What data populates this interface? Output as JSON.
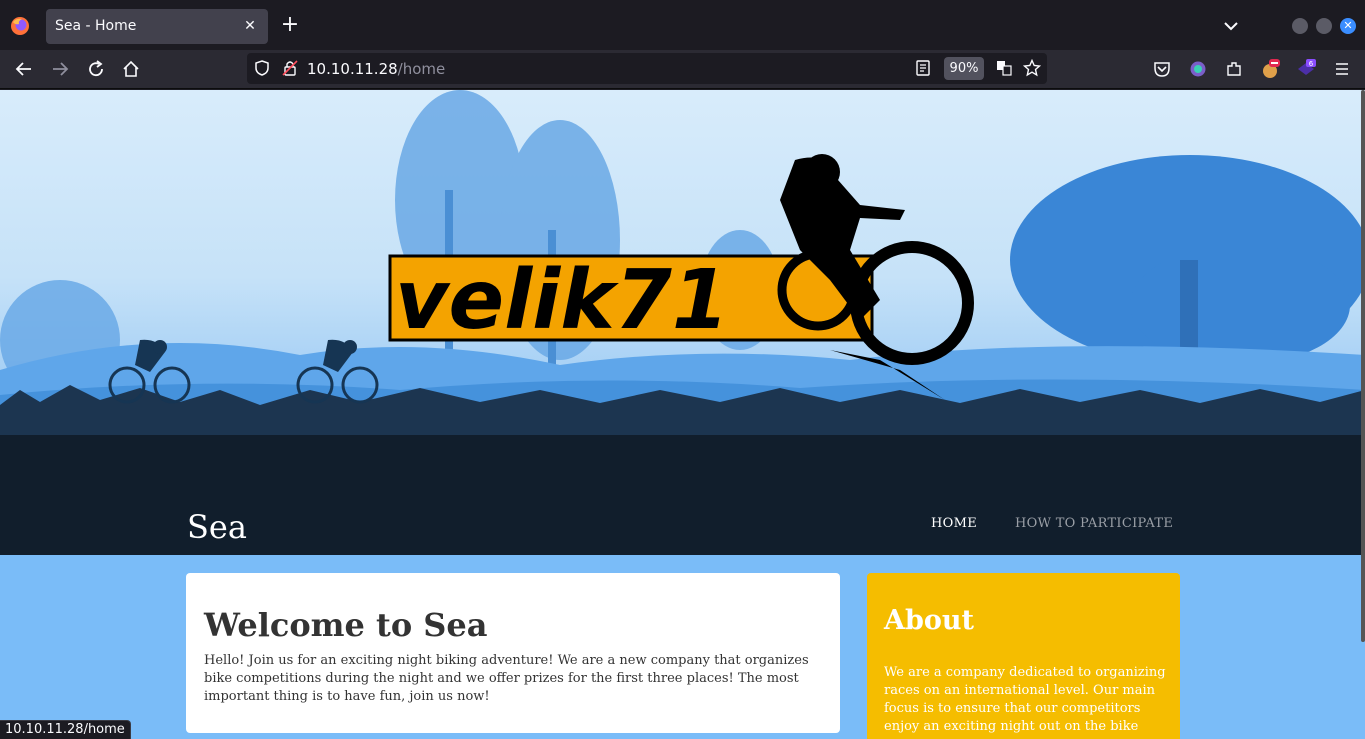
{
  "browser": {
    "tab": {
      "title": "Sea - Home"
    },
    "url": {
      "host": "10.10.11.28",
      "path": "/home"
    },
    "zoom": "90%",
    "status_url": "10.10.11.28/home",
    "extension_badge": "6"
  },
  "site": {
    "logo_text": "velik71",
    "title": "Sea",
    "menu": [
      {
        "label": "HOME"
      },
      {
        "label": "HOW TO PARTICIPATE"
      }
    ],
    "welcome": {
      "heading": "Welcome to Sea",
      "body": "Hello! Join us for an exciting night biking adventure! We are a new company that organizes bike competitions during the night and we offer prizes for the first three places! The most important thing is to have fun, join us now!"
    },
    "about": {
      "heading": "About",
      "body": "We are a company dedicated to organizing races on an international level. Our main focus is to ensure that our competitors enjoy an exciting night out on the bike"
    }
  },
  "colors": {
    "about_card": "#f5bd00",
    "page_bg": "#7abcf8",
    "header_bg": "#111e2c",
    "logo_bg": "#f4a300"
  }
}
